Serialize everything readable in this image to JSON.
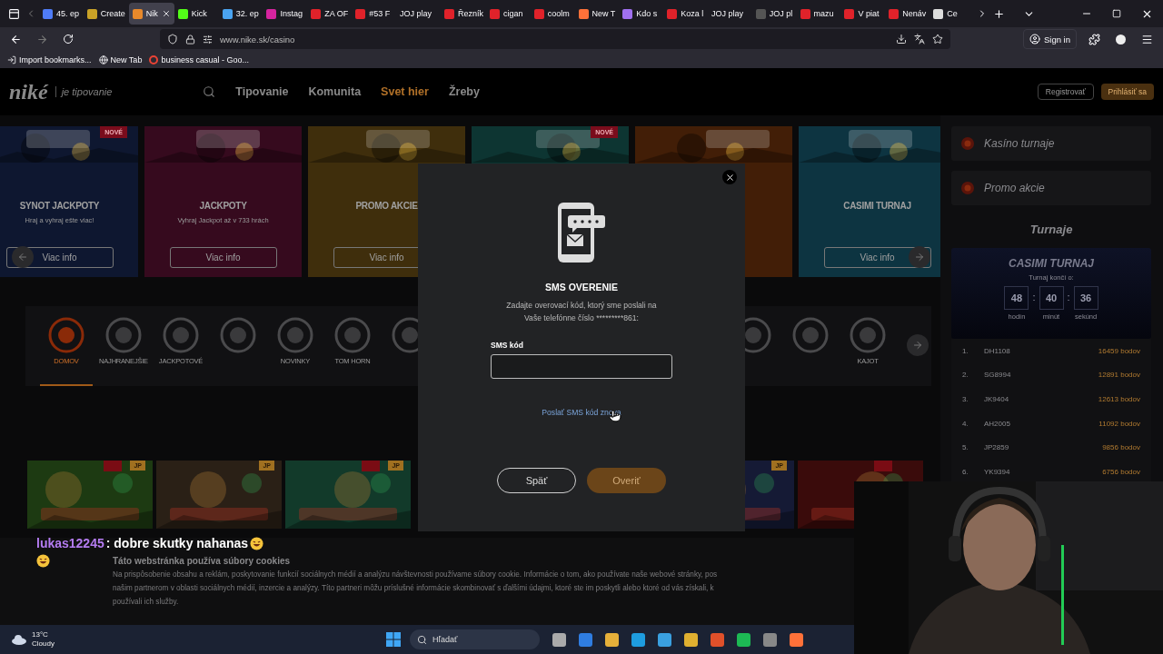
{
  "browser": {
    "tabs": [
      {
        "label": "45. ep",
        "color": "#4f7cf7",
        "selected": false
      },
      {
        "label": "Create",
        "color": "#c9a227",
        "selected": false
      },
      {
        "label": "Nik",
        "color": "#e8892b",
        "selected": true
      },
      {
        "label": "Kick",
        "color": "#53fc18",
        "selected": false
      },
      {
        "label": "32. ep",
        "color": "#4aa3f0",
        "selected": false
      },
      {
        "label": "Instag",
        "color": "#d6249f",
        "selected": false
      },
      {
        "label": "ZA OF",
        "color": "#e0222a",
        "selected": false
      },
      {
        "label": "#53 F",
        "color": "#e0222a",
        "selected": false
      },
      {
        "label": "JOJ play",
        "selected": false
      },
      {
        "label": "Řezník",
        "color": "#e0222a",
        "selected": false
      },
      {
        "label": "cigan",
        "color": "#e0222a",
        "selected": false
      },
      {
        "label": "coolm",
        "color": "#e0222a",
        "selected": false
      },
      {
        "label": "New T",
        "color": "#ff7139",
        "selected": false
      },
      {
        "label": "Kdo s",
        "color": "#a070f0",
        "selected": false
      },
      {
        "label": "Koza l",
        "color": "#e0222a",
        "selected": false
      },
      {
        "label": "JOJ play",
        "selected": false
      },
      {
        "label": "JOJ pl",
        "color": "#555555",
        "selected": false
      },
      {
        "label": "mazu",
        "color": "#e0222a",
        "selected": false
      },
      {
        "label": "V piat",
        "color": "#e0222a",
        "selected": false
      },
      {
        "label": "Nenáv",
        "color": "#e0222a",
        "selected": false
      },
      {
        "label": "Ce",
        "color": "#dddddd",
        "selected": false
      }
    ],
    "address": "www.nike.sk/casino",
    "sign_in": "Sign in",
    "bookmarks": [
      {
        "label": "Import bookmarks...",
        "kind": "import"
      },
      {
        "label": "New Tab",
        "kind": "globe"
      },
      {
        "label": "business casual - Goo...",
        "kind": "google"
      }
    ]
  },
  "site": {
    "logo": "niké",
    "tagline": "je tipovanie",
    "nav": [
      {
        "label": "Tipovanie",
        "selected": false
      },
      {
        "label": "Komunita",
        "selected": false
      },
      {
        "label": "Svet hier",
        "selected": true
      },
      {
        "label": "Žreby",
        "selected": false
      }
    ],
    "register": "Registrovať",
    "login": "Prihlásiť sa",
    "promo_cards": [
      {
        "badge": "NOVÉ",
        "title": "SYNOT JACKPOTY",
        "subtitle": "Hraj a vyhraj ešte viac!",
        "button": "Viac info",
        "color": "#0e1730"
      },
      {
        "title": "JACKPOTY",
        "subtitle": "Vyhraj Jackpot až v 733 hrách",
        "button": "Viac info",
        "color": "#360a1e"
      },
      {
        "title": "PROMO AKCIE",
        "button": "Viac info",
        "color": "#3f2e0c"
      },
      {
        "badge": "NOVÉ",
        "color": "#0d3532"
      },
      {
        "color": "#421e07"
      },
      {
        "title": "CASIMI TURNAJ",
        "button": "Viac info",
        "color": "#0d3441"
      }
    ],
    "categories": [
      {
        "label": "DOMOV",
        "selected": true
      },
      {
        "label": "NAJHRANEJŠIE",
        "selected": false
      },
      {
        "label": "JACKPOTOVÉ",
        "selected": false
      },
      {
        "selected": false
      },
      {
        "label": "NOVINKY",
        "selected": false
      },
      {
        "label": "TOM HORN",
        "selected": false
      },
      {
        "selected": false
      }
    ],
    "categories_right": [
      {
        "selected": false
      },
      {
        "selected": false
      },
      {
        "label": "KAJOT",
        "selected": false
      }
    ],
    "games": [
      {
        "tag": true,
        "jp": "JP",
        "color": "#1d3a12"
      },
      {
        "tag": false,
        "jp": "JP",
        "color": "#2a2016"
      },
      {
        "tag": true,
        "jp": "JP",
        "color": "#123a2a"
      }
    ],
    "games_right": [
      {
        "tag": false,
        "jp": "JP",
        "color": "#151a35"
      },
      {
        "tag": true,
        "color": "#3a0b0b"
      }
    ],
    "sidebar": {
      "links": [
        "Kasíno turnaje",
        "Promo akcie"
      ],
      "heading": "Turnaje",
      "tournament": {
        "title": "CASIMI TURNAJ",
        "ends": "Turnaj končí o:",
        "timer": [
          {
            "value": "48",
            "unit": "hodín"
          },
          {
            "value": "40",
            "unit": "minút"
          },
          {
            "value": "36",
            "unit": "sekúnd"
          }
        ],
        "separators": [
          ":",
          ":"
        ]
      },
      "leaderboard": [
        {
          "rank": "1.",
          "name": "DH1108",
          "points": "16459 bodov"
        },
        {
          "rank": "2.",
          "name": "SG8994",
          "points": "12891 bodov"
        },
        {
          "rank": "3.",
          "name": "JK9404",
          "points": "12613 bodov"
        },
        {
          "rank": "4.",
          "name": "AH2005",
          "points": "11092 bodov"
        },
        {
          "rank": "5.",
          "name": "JP2859",
          "points": "9856 bodov"
        },
        {
          "rank": "6.",
          "name": "YK9394",
          "points": "6756 bodov"
        }
      ]
    },
    "cookies": {
      "title": "Táto webstránka používa súbory cookies",
      "lines": [
        "Na prispôsobenie obsahu a reklám, poskytovanie funkcií sociálnych médií a analýzu návštevnosti používame súbory cookie. Informácie o tom, ako používate naše webové stránky, pos",
        "našim partnerom v oblasti sociálnych médií, inzercie a analýzy. Títo partneri môžu príslušné informácie skombinovať s ďalšími údajmi, ktoré ste im poskytli alebo ktoré od vás získali, k",
        "používali ich služby."
      ]
    }
  },
  "modal": {
    "title": "SMS OVERENIE",
    "text": "Zadajte overovací kód, ktorý sme poslali na Vaše telefónne číslo *********861:",
    "field_label": "SMS kód",
    "resend_link": "Poslať SMS kód znova",
    "back": "Späť",
    "verify": "Overiť"
  },
  "chat": {
    "user": "lukas12245",
    "message": ": dobre skutky nahanas"
  },
  "taskbar": {
    "temperature": "13°C",
    "weather": "Cloudy",
    "search": "Hľadať"
  }
}
